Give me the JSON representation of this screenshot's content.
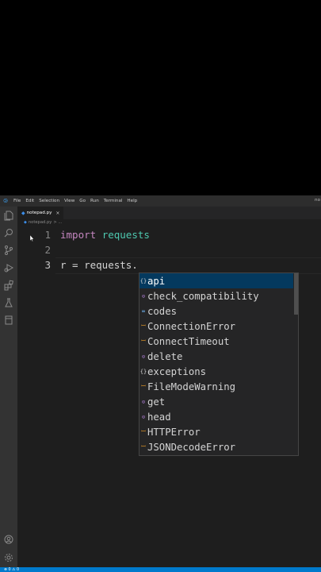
{
  "menubar": {
    "items": [
      "File",
      "Edit",
      "Selection",
      "View",
      "Go",
      "Run",
      "Terminal",
      "Help"
    ],
    "title_right": "no"
  },
  "tab": {
    "label": "notepad.py",
    "close": "×"
  },
  "breadcrumb": {
    "file": "notepad.py",
    "tail": "> ..."
  },
  "editor": {
    "lines": [
      {
        "number": "1",
        "keyword": "import",
        "module": "requests"
      },
      {
        "number": "2"
      },
      {
        "number": "3",
        "text": "r = requests."
      }
    ]
  },
  "suggestions": [
    {
      "label": "api",
      "kind": "module",
      "icon": "{}"
    },
    {
      "label": "check_compatibility",
      "kind": "function",
      "icon": "⊙"
    },
    {
      "label": "codes",
      "kind": "variable",
      "icon": "∞"
    },
    {
      "label": "ConnectionError",
      "kind": "class",
      "icon": "ꟷ"
    },
    {
      "label": "ConnectTimeout",
      "kind": "class",
      "icon": "ꟷ"
    },
    {
      "label": "delete",
      "kind": "function",
      "icon": "⊙"
    },
    {
      "label": "exceptions",
      "kind": "module",
      "icon": "{}"
    },
    {
      "label": "FileModeWarning",
      "kind": "class",
      "icon": "ꟷ"
    },
    {
      "label": "get",
      "kind": "function",
      "icon": "⊙"
    },
    {
      "label": "head",
      "kind": "function",
      "icon": "⊙"
    },
    {
      "label": "HTTPError",
      "kind": "class",
      "icon": "ꟷ"
    },
    {
      "label": "JSONDecodeError",
      "kind": "class",
      "icon": "ꟷ"
    }
  ],
  "statusbar": {
    "text": "⊗ 0 ⚠ 0"
  },
  "colors": {
    "accent": "#007acc",
    "selection": "#04395e",
    "keyword": "#c586c0",
    "module": "#4ec9b0"
  }
}
